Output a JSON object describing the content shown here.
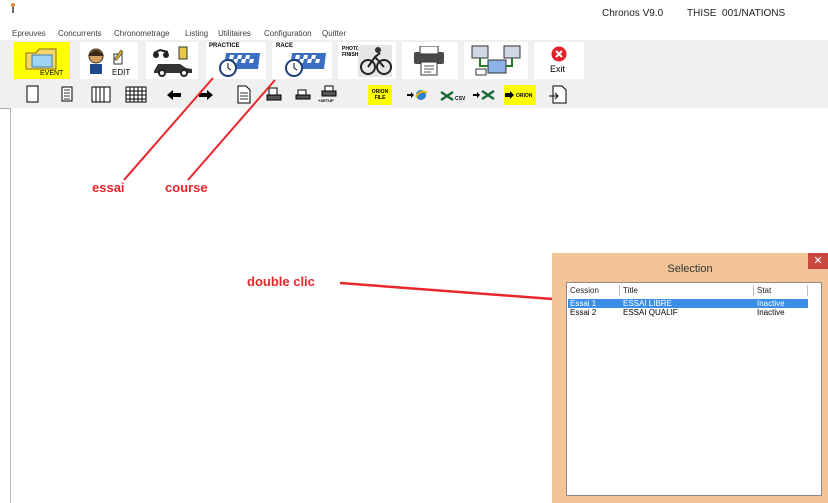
{
  "window": {
    "title": "Chronos V9.0",
    "event": "THISE  001/NATIONS"
  },
  "menu": [
    "Epreuves",
    "Concurrents",
    "Chronometrage",
    "Listing",
    "Utilitaires",
    "Configuration",
    "Quitter"
  ],
  "toolbar_large": {
    "event_label": "EVENT",
    "edit_label": "EDIT",
    "practice_label": "PRACTICE",
    "race_label": "RACE",
    "photo_label": "PHOTO FINISH",
    "exit_label": "Exit"
  },
  "toolbar_small": {
    "setup_label": "+SETUP",
    "orion_file_label": "ORION FILE",
    "csv_label": "CSV",
    "orion_label": "ORION"
  },
  "annotations": {
    "essai": "essai",
    "course": "course",
    "double_clic": "double clic"
  },
  "colors": {
    "annotation": "#e8272c",
    "dialog_bg": "#f3c497",
    "selection": "#3a8ee6",
    "close": "#c9473c"
  },
  "dialog": {
    "title": "Selection",
    "columns": [
      "Cession",
      "Title",
      "Stat"
    ],
    "rows": [
      {
        "cession": "Essai 1",
        "title": "ESSAI LIBRE",
        "stat": "Inactive",
        "selected": true
      },
      {
        "cession": "Essai 2",
        "title": "ESSAI QUALIF",
        "stat": "Inactive",
        "selected": false
      }
    ]
  }
}
